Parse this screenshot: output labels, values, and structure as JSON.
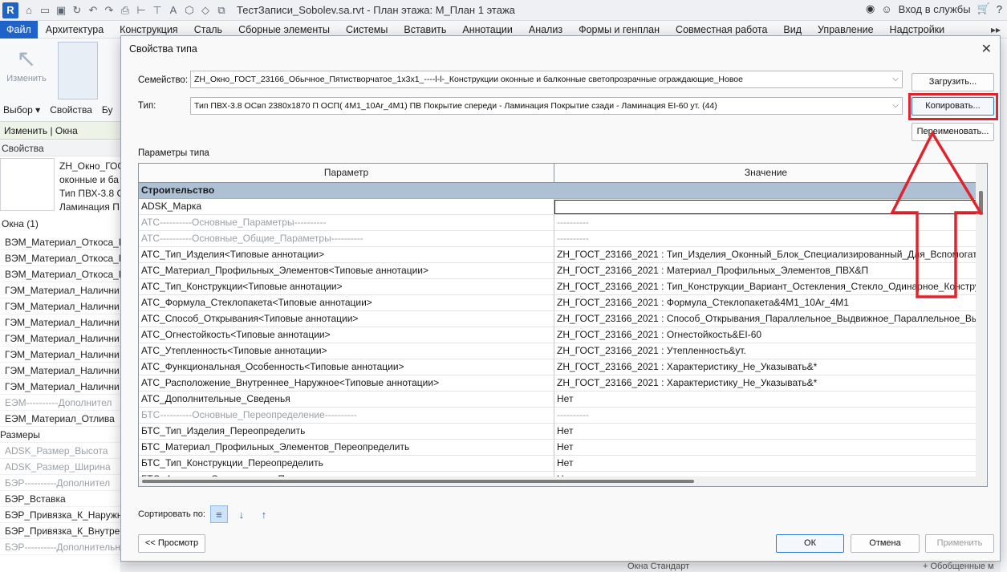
{
  "titlebar": {
    "logo": "R",
    "document_title": "ТестЗаписи_Sobolev.sa.rvt - План этажа: М_План 1 этажа",
    "signin": "Вход в службы",
    "help": "?"
  },
  "ribbon": {
    "tabs": [
      "Файл",
      "Архитектура",
      "Конструкция",
      "Сталь",
      "Сборные элементы",
      "Системы",
      "Вставить",
      "Аннотации",
      "Анализ",
      "Формы и генплан",
      "Совместная работа",
      "Вид",
      "Управление",
      "Надстройки"
    ],
    "overflow": "▸▸",
    "modify_label": "Изменить",
    "select_label": "Выбор ▾",
    "properties_label": "Свойства",
    "trunc_label": "Бу",
    "context_bar": "Изменить | Окна"
  },
  "palette": {
    "header": "Свойства",
    "type_name_lines": [
      "ZH_Окно_ГОС",
      "оконные и ба",
      "Тип ПВХ-3.8 С",
      "Ламинация П"
    ],
    "instance_count": "Окна (1)",
    "rows": [
      {
        "text": "ВЭМ_Материал_Откоса_Н",
        "grey": false
      },
      {
        "text": "ВЭМ_Материал_Откоса_Н",
        "grey": false
      },
      {
        "text": "ВЭМ_Материал_Откоса_Н",
        "grey": false
      },
      {
        "text": "ГЭМ_Материал_Налични",
        "grey": false
      },
      {
        "text": "ГЭМ_Материал_Налични",
        "grey": false
      },
      {
        "text": "ГЭМ_Материал_Налични",
        "grey": false
      },
      {
        "text": "ГЭМ_Материал_Налични",
        "grey": false
      },
      {
        "text": "ГЭМ_Материал_Налични",
        "grey": false
      },
      {
        "text": "ГЭМ_Материал_Налични",
        "grey": false
      },
      {
        "text": "ГЭМ_Материал_Налични",
        "grey": false
      },
      {
        "text": "ЕЭМ----------Дополнител",
        "grey": true
      },
      {
        "text": "ЕЭМ_Материал_Отлива",
        "grey": false
      }
    ],
    "group2": "Размеры",
    "rows2": [
      {
        "text": "ADSK_Размер_Высота",
        "grey": true
      },
      {
        "text": "ADSK_Размер_Ширина",
        "grey": true
      },
      {
        "text": "БЭР----------Дополнител",
        "grey": true
      },
      {
        "text": "БЭР_Вставка",
        "grey": false
      },
      {
        "text": "БЭР_Привязка_К_Наружн",
        "grey": false
      },
      {
        "text": "БЭР_Привязка_К_Внутрен",
        "grey": false
      },
      {
        "text": "БЭР----------Дополнительные_Монтажны",
        "grey": true
      }
    ]
  },
  "dialog": {
    "title": "Свойства типа",
    "family_label": "Семейство:",
    "family_value": "ZH_Окно_ГОСТ_23166_Обычное_Пятистворчатое_1х3х1_----l-l-_Конструкции оконные и балконные светопрозрачные ограждающие_Новое",
    "type_label": "Тип:",
    "type_value": "Тип ПВХ-3.8 ОСвп 2380х1870 П ОСП( 4М1_10Ar_4М1) ПВ Покрытие спереди - Ламинация Покрытие сзади - Ламинация EI-60 ут. (44)",
    "load_button": "Загрузить...",
    "copy_button": "Копировать...",
    "rename_button": "Переименовать...",
    "type_params_label": "Параметры типа",
    "col_param": "Параметр",
    "col_value": "Значение",
    "group_construction": "Строительство",
    "rows": [
      {
        "param": "ADSK_Марка",
        "value": "",
        "grey": false,
        "edit": true
      },
      {
        "param": "АТС----------Основные_Параметры----------",
        "value": "----------",
        "grey": true
      },
      {
        "param": "АТС----------Основные_Общие_Параметры----------",
        "value": "----------",
        "grey": true
      },
      {
        "param": "АТС_Тип_Изделия<Типовые аннотации>",
        "value": "ZH_ГОСТ_23166_2021 : Тип_Изделия_Оконный_Блок_Специализированный_Для_Вспомогат",
        "grey": false
      },
      {
        "param": "АТС_Материал_Профильных_Элементов<Типовые аннотации>",
        "value": "ZH_ГОСТ_23166_2021 : Материал_Профильных_Элементов_ПВХ&П",
        "grey": false
      },
      {
        "param": "АТС_Тип_Конструкции<Типовые аннотации>",
        "value": "ZH_ГОСТ_23166_2021 : Тип_Конструкции_Вариант_Остекления_Стекло_Одинарное_Констру",
        "grey": false
      },
      {
        "param": "АТС_Формула_Стеклопакета<Типовые аннотации>",
        "value": "ZH_ГОСТ_23166_2021 : Формула_Стеклопакета&4М1_10Ar_4М1",
        "grey": false
      },
      {
        "param": "АТС_Способ_Открывания<Типовые аннотации>",
        "value": "ZH_ГОСТ_23166_2021 : Способ_Открывания_Параллельное_Выдвижное_Параллельное_Вы",
        "grey": false
      },
      {
        "param": "АТС_Огнестойкость<Типовые аннотации>",
        "value": "ZH_ГОСТ_23166_2021 : Огнестойкость&EI-60",
        "grey": false
      },
      {
        "param": "АТС_Утепленность<Типовые аннотации>",
        "value": "ZH_ГОСТ_23166_2021 : Утепленность&ут.",
        "grey": false
      },
      {
        "param": "АТС_Функциональная_Особенность<Типовые аннотации>",
        "value": "ZH_ГОСТ_23166_2021 : Характеристику_Не_Указывать&*",
        "grey": false
      },
      {
        "param": "АТС_Расположение_Внутреннее_Наружное<Типовые аннотации>",
        "value": "ZH_ГОСТ_23166_2021 : Характеристику_Не_Указывать&*",
        "grey": false
      },
      {
        "param": "АТС_Дополнительные_Сведенья",
        "value": "Нет",
        "grey": false
      },
      {
        "param": "БТС----------Основные_Переопределение----------",
        "value": "----------",
        "grey": true
      },
      {
        "param": "БТС_Тип_Изделия_Переопределить",
        "value": "Нет",
        "grey": false
      },
      {
        "param": "БТС_Материал_Профильных_Элементов_Переопределить",
        "value": "Нет",
        "grey": false
      },
      {
        "param": "БТС_Тип_Конструкции_Переопределить",
        "value": "Нет",
        "grey": false
      },
      {
        "param": "БТС_Формула_Стеклопакета_Переопределить",
        "value": "Нет",
        "grey": false
      }
    ],
    "sort_label": "Сортировать по:",
    "preview_button": "<< Просмотр",
    "ok_button": "ОК",
    "cancel_button": "Отмена",
    "apply_button": "Применить"
  },
  "bottom": {
    "hint": "Окна Стандарт",
    "right_hint": "+ Обобщенные м"
  },
  "colors": {
    "accent": "#1f62c9",
    "highlight_red": "#e0232c",
    "group_row": "#aec0d4"
  }
}
